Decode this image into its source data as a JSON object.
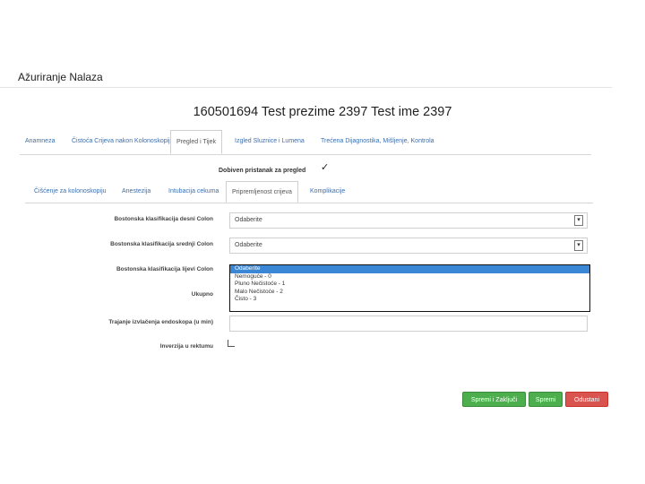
{
  "modal": {
    "title": "Ažuriranje Nalaza"
  },
  "patient": {
    "header": "160501694 Test prezime 2397 Test ime 2397"
  },
  "main_tabs": [
    {
      "label": "Anamneza"
    },
    {
      "label": "Čistoća Crijeva nakon Kolonoskopije"
    },
    {
      "label": "Pregled i Tijek"
    },
    {
      "label": "Izgled Sluznice i Lumena"
    },
    {
      "label": "Trećena Dijagnostika, Mišljenje, Kontrola"
    }
  ],
  "consent": {
    "label": "Dobiven pristanak za pregled",
    "checked": true
  },
  "sub_tabs": [
    {
      "label": "Čišćenje za kolonoskopiju"
    },
    {
      "label": "Anestezija"
    },
    {
      "label": "Intubacija cekuma"
    },
    {
      "label": "Pripremljenost crijeva"
    },
    {
      "label": "Komplikacije"
    }
  ],
  "form": {
    "boston_right": {
      "label": "Bostonska klasifikacija desni Colon",
      "value": "Odaberite"
    },
    "boston_middle": {
      "label": "Bostonska klasifikacija srednji Colon",
      "value": "Odaberite"
    },
    "boston_left": {
      "label": "Bostonska klasifikacija lijevi Colon"
    },
    "total": {
      "label": "Ukupno"
    },
    "duration": {
      "label": "Trajanje izvlačenja endoskopa (u min)"
    },
    "inversion": {
      "label": "Inverzija u rektumu"
    }
  },
  "dropdown_options": [
    {
      "label": "Odaberite",
      "selected": true
    },
    {
      "label": "Nemoguće - 0",
      "selected": false
    },
    {
      "label": "Pluno Nečistoće - 1",
      "selected": false
    },
    {
      "label": "Malo Nečistoće - 2",
      "selected": false
    },
    {
      "label": "Čisto - 3",
      "selected": false
    }
  ],
  "buttons": {
    "save_close": "Spremi i Zaključi",
    "save": "Spremi",
    "cancel": "Odustani"
  },
  "colors": {
    "primary_green": "#4cae4c",
    "danger_red": "#d9534f",
    "selection_blue": "#3a87d6",
    "link_blue": "#3a6fb0"
  }
}
